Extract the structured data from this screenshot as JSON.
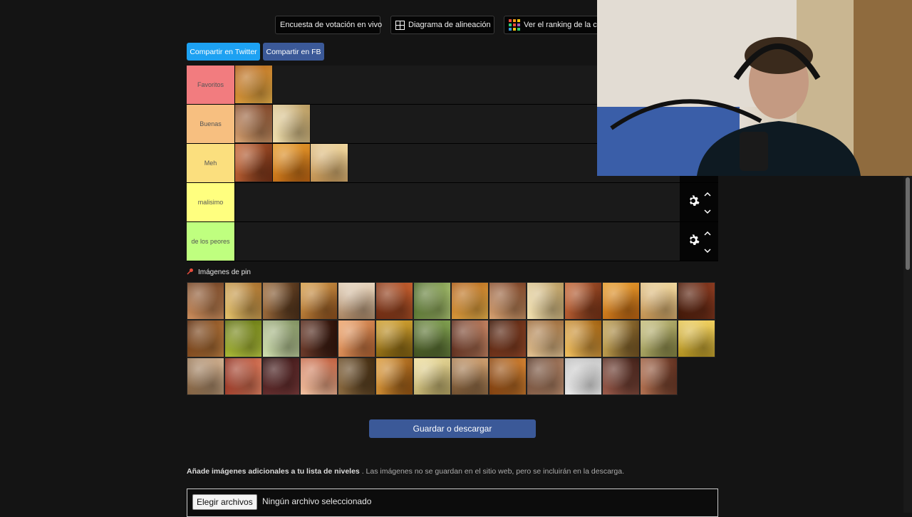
{
  "top_buttons": [
    {
      "label": "Encuesta de votación en vivo",
      "icon": "none"
    },
    {
      "label": "Diagrama de alineación",
      "icon": "grid-icon"
    },
    {
      "label": "Ver el ranking de la co",
      "icon": "colorful-grid-icon"
    }
  ],
  "share": {
    "twitter": "Compartir en Twitter",
    "facebook": "Compartir en FB",
    "twitter_color": "#1da1f2",
    "facebook_color": "#3b5998"
  },
  "tiers": [
    {
      "label": "Favoritos",
      "color": "#f27c7f",
      "items": 1
    },
    {
      "label": "Buenas",
      "color": "#f7bf80",
      "items": 2
    },
    {
      "label": "Meh",
      "color": "#fbdf7e",
      "items": 3
    },
    {
      "label": "malisimo",
      "color": "#ffff7f",
      "items": 0
    },
    {
      "label": "de los peores",
      "color": "#bfff7f",
      "items": 0
    }
  ],
  "pinned_label": "Imágenes de pin",
  "pool_count": 41,
  "save_button": "Guardar o descargar",
  "add_images": {
    "title": "Añade imágenes adicionales a tu lista de niveles",
    "note": ". Las imágenes no se guardan en el sitio web, pero se incluirán en la descarga."
  },
  "file_input": {
    "button": "Elegir archivos",
    "status": "Ningún archivo seleccionado"
  },
  "colors": {
    "background": "#141414",
    "save_button": "#3b5998"
  }
}
